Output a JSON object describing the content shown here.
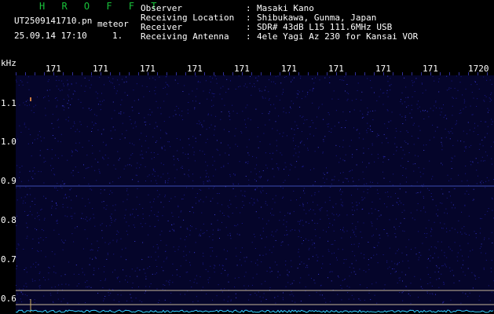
{
  "header": {
    "program": "H R O F F T",
    "filename": "UT2509141710.pn",
    "tag": "meteor",
    "datetime": "25.09.14 17:10",
    "page": "1.",
    "fields": [
      {
        "label": "Observer",
        "value": "Masaki Kano"
      },
      {
        "label": "Receiving Location",
        "value": "Shibukawa, Gunma, Japan"
      },
      {
        "label": "Receiver",
        "value": "SDR# 43dB L15 111.6MHz USB"
      },
      {
        "label": "Receiving Antenna",
        "value": "4ele Yagi Az 230 for Kansai VOR"
      }
    ]
  },
  "axis": {
    "y_unit": "kHz",
    "y_ticks": [
      "1.1",
      "1.0",
      "0.9",
      "0.8",
      "0.7",
      "0.6"
    ],
    "x_ticks": [
      "171",
      "171",
      "171",
      "171",
      "171",
      "171",
      "171",
      "171",
      "171",
      "1720"
    ]
  },
  "colors": {
    "background": "#000000",
    "noise": "#1a1a8c",
    "signal": "#35d0ff",
    "title": "#18c23a"
  }
}
